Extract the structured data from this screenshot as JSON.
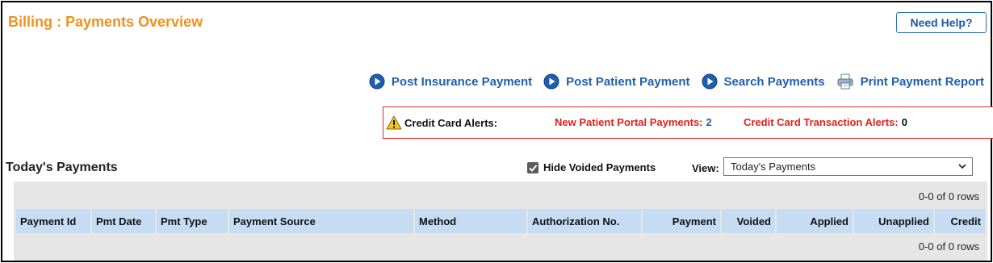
{
  "header": {
    "title": "Billing : Payments Overview",
    "help_label": "Need Help?"
  },
  "actions": [
    {
      "label": "Post Insurance Payment",
      "icon": "play-circle-icon"
    },
    {
      "label": "Post Patient Payment",
      "icon": "play-circle-icon"
    },
    {
      "label": "Search Payments",
      "icon": "play-circle-icon"
    },
    {
      "label": "Print Payment Report",
      "icon": "printer-icon"
    }
  ],
  "alerts": {
    "label": "Credit Card Alerts:",
    "portal_label": "New Patient Portal Payments:",
    "portal_count": "2",
    "cc_label": "Credit Card Transaction Alerts:",
    "cc_count": "0"
  },
  "payments": {
    "title": "Today's Payments",
    "hide_voided_label": "Hide Voided Payments",
    "hide_voided_checked": true,
    "view_label": "View:",
    "view_value": "Today's Payments",
    "row_info": "0-0 of 0 rows",
    "columns": [
      "Payment Id",
      "Pmt Date",
      "Pmt Type",
      "Payment Source",
      "Method",
      "Authorization No.",
      "Payment",
      "Voided",
      "Applied",
      "Unapplied",
      "Credit"
    ]
  },
  "colors": {
    "title": "#f0911e",
    "link": "#1f5fad",
    "alert_red": "#e02020",
    "header_blue": "#c5dcf2",
    "grid_bg": "#e6e6e6"
  }
}
